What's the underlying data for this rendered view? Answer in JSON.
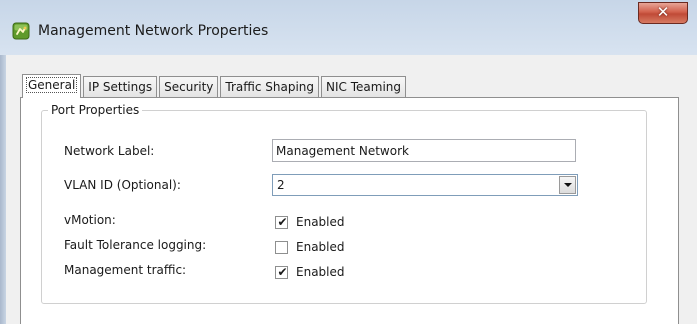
{
  "window": {
    "title": "Management Network Properties",
    "close_glyph": "✕"
  },
  "tabs": [
    {
      "label": "General",
      "active": true
    },
    {
      "label": "IP Settings",
      "active": false
    },
    {
      "label": "Security",
      "active": false
    },
    {
      "label": "Traffic Shaping",
      "active": false
    },
    {
      "label": "NIC Teaming",
      "active": false
    }
  ],
  "port_properties": {
    "group_title": "Port Properties",
    "network_label": {
      "label": "Network Label:",
      "value": "Management Network"
    },
    "vlan_id": {
      "label": "VLAN ID (Optional):",
      "value": "2"
    },
    "vmotion": {
      "label": "vMotion:",
      "checkbox_label": "Enabled",
      "checked": true
    },
    "fault_tolerance": {
      "label": "Fault Tolerance logging:",
      "checkbox_label": "Enabled",
      "checked": false
    },
    "management_traffic": {
      "label": "Management traffic:",
      "checkbox_label": "Enabled",
      "checked": true
    }
  },
  "icons": {
    "app": "vsphere-network-icon",
    "checkmark_glyph": "✔"
  },
  "colors": {
    "title_gradient_top": "#c7d6e8",
    "client_bg": "#f0f0f0",
    "close_red": "#c04a37",
    "panel_bg": "#ffffff"
  }
}
